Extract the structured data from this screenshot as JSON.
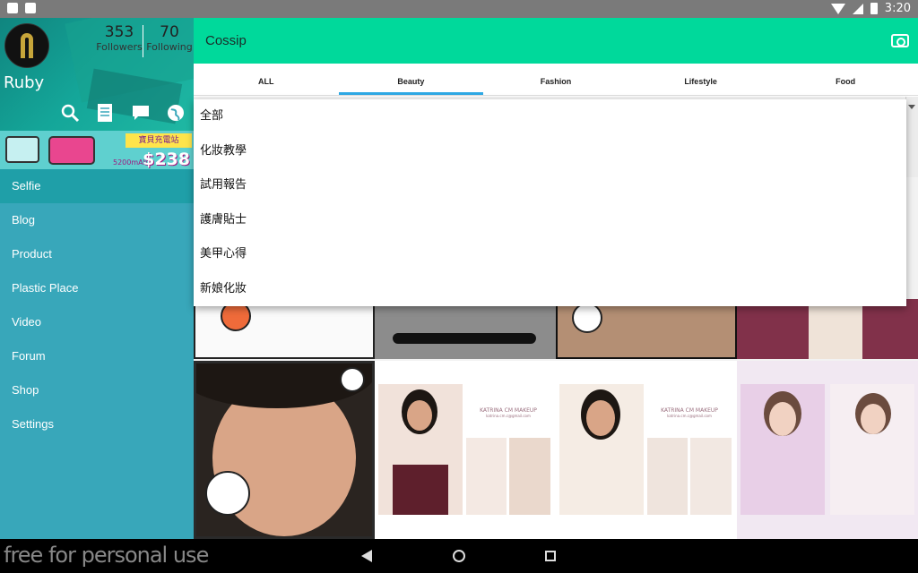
{
  "status": {
    "time": "3:20",
    "battery": "8"
  },
  "profile": {
    "name": "Ruby",
    "followers_count": "353",
    "followers_label": "Followers",
    "following_count": "70",
    "following_label": "Following"
  },
  "banner": {
    "tag": "寶貝充電站",
    "price": "$238",
    "sub": "5200mAh"
  },
  "sidebar": {
    "items": [
      {
        "label": "Selfie"
      },
      {
        "label": "Blog"
      },
      {
        "label": "Product"
      },
      {
        "label": "Plastic Place"
      },
      {
        "label": "Video"
      },
      {
        "label": "Forum"
      },
      {
        "label": "Shop"
      },
      {
        "label": "Settings"
      }
    ]
  },
  "appbar": {
    "title": "Cossip"
  },
  "tabs": [
    {
      "label": "ALL"
    },
    {
      "label": "Beauty"
    },
    {
      "label": "Fashion"
    },
    {
      "label": "Lifestyle"
    },
    {
      "label": "Food"
    }
  ],
  "dropdown": {
    "items": [
      {
        "label": "全部"
      },
      {
        "label": "化妝教學"
      },
      {
        "label": "試用報告"
      },
      {
        "label": "護膚貼士"
      },
      {
        "label": "美甲心得"
      },
      {
        "label": "新娘化妝"
      }
    ]
  },
  "tiles": {
    "katrina_title": "KATRINA CM MAKEUP",
    "katrina_email": "katrina.cm.c@gmail.com"
  },
  "watermark": "free for personal use",
  "colors": {
    "appbar": "#00d99b",
    "sidebar": "#38a7ba",
    "sidebar_active": "#1f9fa8",
    "tab_indicator": "#2ea8e4"
  }
}
